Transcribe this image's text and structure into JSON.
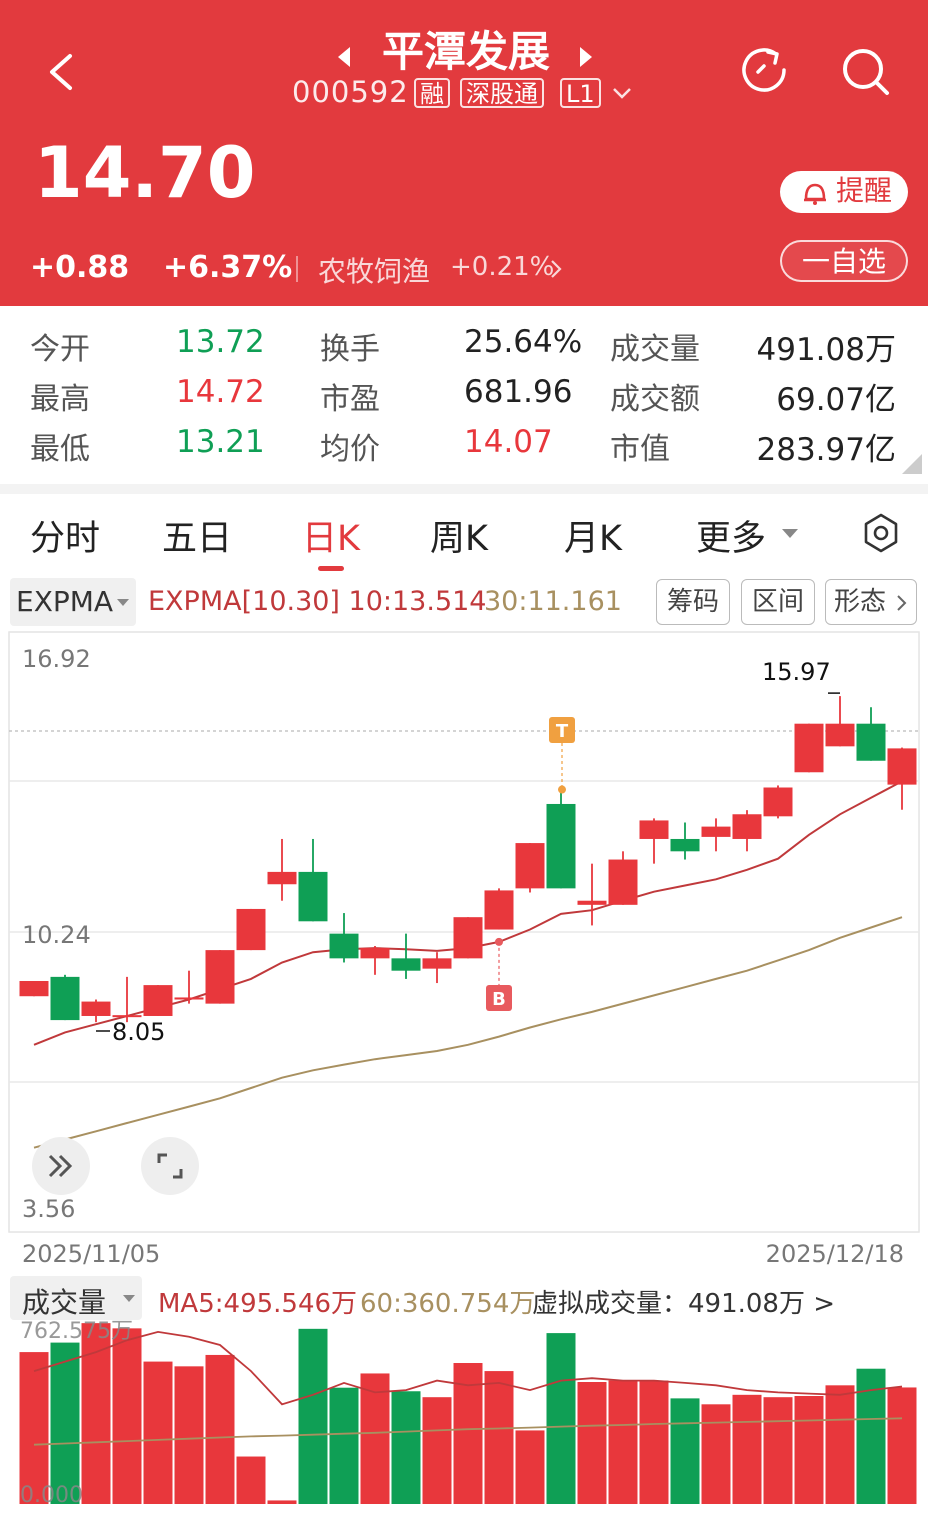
{
  "header": {
    "title": "平潭发展",
    "code": "000592",
    "tags": [
      "融",
      "深股通",
      "L1"
    ],
    "price": "14.70",
    "change": "+0.88",
    "change_pct": "+6.37%",
    "sector_name": "农牧饲渔",
    "sector_change": "+0.21%",
    "alert_label": "提醒",
    "watch_label": "一自选"
  },
  "stats": {
    "open_label": "今开",
    "open": "13.72",
    "turnover_label": "换手",
    "turnover": "25.64%",
    "volume_label": "成交量",
    "volume": "491.08万",
    "high_label": "最高",
    "high": "14.72",
    "pe_label": "市盈",
    "pe": "681.96",
    "amount_label": "成交额",
    "amount": "69.07亿",
    "low_label": "最低",
    "low": "13.21",
    "avg_label": "均价",
    "avg": "14.07",
    "mcap_label": "市值",
    "mcap": "283.97亿"
  },
  "tabs": [
    "分时",
    "五日",
    "日K",
    "周K",
    "月K",
    "更多"
  ],
  "indicator": {
    "selector": "EXPMA",
    "summary": "EXPMA[10.30] 10:13.514",
    "ema30": "30:11.161",
    "chips": [
      "筹码",
      "区间",
      "形态"
    ]
  },
  "colors": {
    "up": "#e8373c",
    "down": "#0f9f55",
    "ema10": "#c0393b",
    "ema30": "#a89060",
    "brand": "#e23a3e"
  },
  "chart_data": [
    {
      "type": "candlestick",
      "title": "",
      "ylim": [
        3.56,
        16.92
      ],
      "y_ticks": [
        "16.92",
        "10.24",
        "3.56"
      ],
      "x_start": "2025/11/05",
      "x_end": "2025/12/18",
      "max_label": "15.97",
      "min_label": "8.05",
      "marker_buy": "B",
      "marker_top": "T",
      "candles": [
        {
          "o": 9.05,
          "h": 9.05,
          "l": 8.68,
          "c": 8.68,
          "dir": "up"
        },
        {
          "o": 9.15,
          "h": 9.2,
          "l": 8.1,
          "c": 8.1,
          "dir": "down"
        },
        {
          "o": 8.2,
          "h": 8.6,
          "l": 8.05,
          "c": 8.55,
          "dir": "up"
        },
        {
          "o": 8.2,
          "h": 9.15,
          "l": 8.05,
          "c": 8.22,
          "dir": "up"
        },
        {
          "o": 8.2,
          "h": 8.95,
          "l": 8.2,
          "c": 8.95,
          "dir": "up"
        },
        {
          "o": 8.6,
          "h": 9.3,
          "l": 8.5,
          "c": 8.65,
          "dir": "up"
        },
        {
          "o": 8.5,
          "h": 9.8,
          "l": 8.5,
          "c": 9.8,
          "dir": "up"
        },
        {
          "o": 9.8,
          "h": 10.8,
          "l": 9.8,
          "c": 10.8,
          "dir": "up"
        },
        {
          "o": 11.4,
          "h": 12.5,
          "l": 11.0,
          "c": 11.7,
          "dir": "up"
        },
        {
          "o": 11.7,
          "h": 12.5,
          "l": 10.5,
          "c": 10.5,
          "dir": "down"
        },
        {
          "o": 10.2,
          "h": 10.7,
          "l": 9.5,
          "c": 9.6,
          "dir": "down"
        },
        {
          "o": 9.6,
          "h": 9.9,
          "l": 9.2,
          "c": 9.85,
          "dir": "up"
        },
        {
          "o": 9.6,
          "h": 10.2,
          "l": 9.1,
          "c": 9.3,
          "dir": "down"
        },
        {
          "o": 9.35,
          "h": 9.75,
          "l": 9.0,
          "c": 9.6,
          "dir": "up"
        },
        {
          "o": 9.6,
          "h": 10.6,
          "l": 9.6,
          "c": 10.6,
          "dir": "up"
        },
        {
          "o": 10.3,
          "h": 11.3,
          "l": 10.3,
          "c": 11.25,
          "dir": "up"
        },
        {
          "o": 11.3,
          "h": 12.4,
          "l": 11.2,
          "c": 12.4,
          "dir": "up"
        },
        {
          "o": 13.35,
          "h": 13.7,
          "l": 11.3,
          "c": 11.3,
          "dir": "down"
        },
        {
          "o": 10.9,
          "h": 11.9,
          "l": 10.4,
          "c": 11.0,
          "dir": "up"
        },
        {
          "o": 10.9,
          "h": 12.2,
          "l": 10.9,
          "c": 12.0,
          "dir": "up"
        },
        {
          "o": 12.5,
          "h": 13.0,
          "l": 11.9,
          "c": 12.95,
          "dir": "up"
        },
        {
          "o": 12.5,
          "h": 12.9,
          "l": 12.0,
          "c": 12.2,
          "dir": "down"
        },
        {
          "o": 12.55,
          "h": 13.0,
          "l": 12.2,
          "c": 12.8,
          "dir": "up"
        },
        {
          "o": 12.5,
          "h": 13.2,
          "l": 12.2,
          "c": 13.1,
          "dir": "up"
        },
        {
          "o": 13.05,
          "h": 13.8,
          "l": 13.0,
          "c": 13.75,
          "dir": "up"
        },
        {
          "o": 14.12,
          "h": 15.3,
          "l": 14.12,
          "c": 15.3,
          "dir": "up"
        },
        {
          "o": 14.75,
          "h": 15.97,
          "l": 14.75,
          "c": 15.3,
          "dir": "up"
        },
        {
          "o": 15.3,
          "h": 15.7,
          "l": 14.4,
          "c": 14.4,
          "dir": "down"
        },
        {
          "o": 13.82,
          "h": 14.72,
          "l": 13.21,
          "c": 14.7,
          "dir": "up"
        }
      ],
      "ema10": [
        7.5,
        7.8,
        8.0,
        8.2,
        8.4,
        8.6,
        8.85,
        9.1,
        9.5,
        9.75,
        9.82,
        9.85,
        9.82,
        9.78,
        9.85,
        10.0,
        10.3,
        10.68,
        10.77,
        11.0,
        11.22,
        11.37,
        11.52,
        11.75,
        12.02,
        12.6,
        13.1,
        13.5,
        13.9
      ],
      "ema30": [
        5.0,
        5.2,
        5.4,
        5.6,
        5.8,
        6.0,
        6.2,
        6.45,
        6.7,
        6.88,
        7.02,
        7.15,
        7.25,
        7.35,
        7.5,
        7.7,
        7.92,
        8.12,
        8.3,
        8.5,
        8.7,
        8.9,
        9.1,
        9.3,
        9.55,
        9.8,
        10.1,
        10.35,
        10.6
      ]
    },
    {
      "type": "bar",
      "title": "",
      "selector": "成交量",
      "ma5_text": "MA5:495.546万",
      "ma60_text": "60:360.754万",
      "virtual_text": "虚拟成交量：491.08万 >",
      "y_top_label": "762.575万",
      "y_bottom_label": "0.000",
      "ylim": [
        0,
        762.575
      ],
      "values": [
        640,
        680,
        762,
        740,
        600,
        580,
        628,
        200,
        15,
        738,
        490,
        550,
        475,
        450,
        594,
        560,
        310,
        720,
        514,
        520,
        520,
        445,
        420,
        460,
        450,
        455,
        500,
        570,
        491
      ],
      "dirs": [
        "up",
        "down",
        "up",
        "up",
        "up",
        "up",
        "up",
        "up",
        "up",
        "down",
        "down",
        "up",
        "down",
        "up",
        "up",
        "up",
        "up",
        "down",
        "up",
        "up",
        "up",
        "down",
        "up",
        "up",
        "up",
        "up",
        "up",
        "down",
        "up"
      ],
      "ma5": [
        560,
        600,
        640,
        690,
        725,
        705,
        670,
        560,
        420,
        460,
        510,
        470,
        480,
        520,
        500,
        510,
        480,
        520,
        530,
        520,
        520,
        510,
        500,
        480,
        470,
        465,
        460,
        480,
        495
      ],
      "ma60": [
        250,
        255,
        260,
        265,
        270,
        275,
        280,
        285,
        288,
        292,
        296,
        300,
        305,
        310,
        315,
        318,
        322,
        326,
        330,
        333,
        337,
        340,
        343,
        346,
        349,
        352,
        355,
        358,
        361
      ]
    }
  ]
}
